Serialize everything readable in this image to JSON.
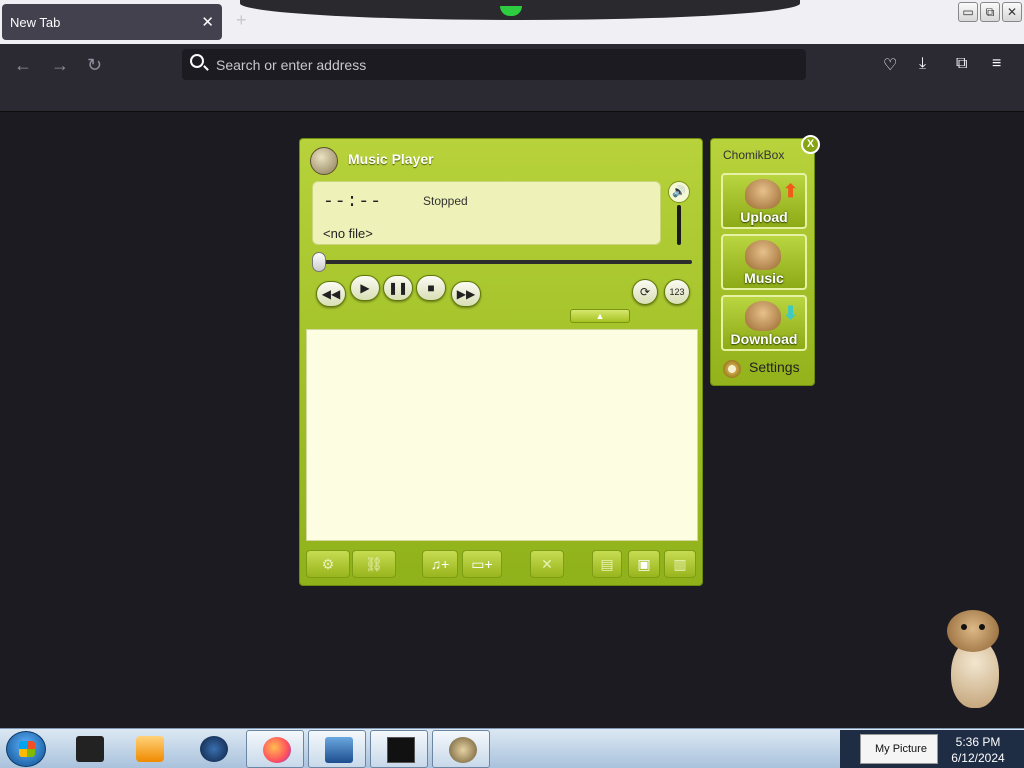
{
  "browser": {
    "tab_title": "New Tab",
    "tab_close": "✕",
    "new_tab": "+",
    "address_placeholder": "Search or enter address"
  },
  "window_controls": {
    "minimize": "▭",
    "restore": "⧉",
    "close": "✕"
  },
  "toolbar_icons": [
    "back-icon",
    "forward-icon",
    "reload-icon",
    "pocket-icon",
    "download-icon",
    "extensions-icon",
    "menu-icon"
  ],
  "music_player": {
    "title": "Music Player",
    "time": "--:--",
    "status": "Stopped",
    "file": "<no file>",
    "volume_icon": "🔊",
    "progress": 0,
    "controls": {
      "rewind": "◀◀",
      "play": "▶",
      "pause": "❚❚",
      "stop": "■",
      "forward": "▶▶",
      "repeat": "⟳",
      "shuffle": "123"
    },
    "collapse": "▲",
    "playlist": [],
    "playlist_buttons": [
      "tools-icon",
      "link-icon",
      "add-file-icon",
      "add-folder-icon",
      "remove-icon",
      "new-playlist-icon",
      "save-playlist-icon",
      "open-playlist-icon"
    ]
  },
  "chomikbox": {
    "title": "ChomikBox",
    "close": "X",
    "upload": "Upload",
    "music": "Music",
    "download": "Download",
    "settings": "Settings"
  },
  "taskbar": {
    "tray_label": "My Picture",
    "time": "5:36 PM",
    "date": "6/12/2024"
  },
  "colors": {
    "player_green": "#a6c322",
    "playlist_bg": "#fdfde1",
    "browser_bg": "#1c1b22"
  }
}
